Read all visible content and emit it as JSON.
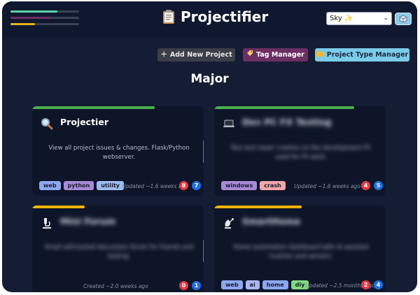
{
  "header": {
    "app_title": "Projectifier",
    "title_icon": "clipboard-icon",
    "progress_bars": [
      {
        "color": "#5dd6a8",
        "fill": 0.68
      },
      {
        "color": "#6b2f63",
        "fill": 0.58
      },
      {
        "color": "#e5b31f",
        "fill": 0.36
      }
    ],
    "theme_select": {
      "value": "Sky ✨"
    },
    "theme_button_icon": "cube-icon"
  },
  "toolbar": {
    "add_project": {
      "label": "Add New Project",
      "icon": "plus-icon"
    },
    "tag_manager": {
      "label": "Tag Manager",
      "icon": "tag-icon"
    },
    "project_type_manager": {
      "label": "Project Type Manager",
      "icon": "folder-icon"
    }
  },
  "section": {
    "title": "Major"
  },
  "colors": {
    "accent_green": "#4caf50",
    "accent_yellow": "#f5b400",
    "badge_red": "#e63946",
    "badge_blue": "#1e6fe8"
  },
  "cards": [
    {
      "name": "Projectier",
      "icon": "magnifier-icon",
      "description": "View all project issues & changes. Flask/Python webserver.",
      "tags": [
        {
          "label": "web",
          "color": "#8da7f0"
        },
        {
          "label": "python",
          "color": "#a78bd6"
        },
        {
          "label": "utility",
          "color": "#9dbdf1"
        }
      ],
      "status": "Updated ~1.6 weeks ago",
      "counts": {
        "red": "8",
        "blue": "7"
      },
      "accent": "#4caf50"
    },
    {
      "name": "Dev PC FX Testing",
      "icon": "laptop-icon",
      "description": "Test and repair crashes on the development PC used for FX work.",
      "tags": [
        {
          "label": "windows",
          "color": "#a78bd6"
        },
        {
          "label": "crash",
          "color": "#f0a8a8"
        }
      ],
      "status": "Updated ~1.6 weeks ago",
      "counts": {
        "red": "4",
        "blue": "5"
      },
      "accent": "#4caf50"
    },
    {
      "name": "Mini Forum",
      "icon": "microscope-icon",
      "description": "Small self-hosted discussion forum for friends and testing.",
      "tags": [],
      "status": "Created ~2.0 weeks ago",
      "counts": {
        "red": "0",
        "blue": "1"
      },
      "accent": "#f5b400"
    },
    {
      "name": "SmartHome",
      "icon": "satellite-icon",
      "description": "Home automation dashboard with AI assisted routines and sensors.",
      "tags": [
        {
          "label": "web",
          "color": "#8da7f0"
        },
        {
          "label": "ai",
          "color": "#a8b8f0"
        },
        {
          "label": "home",
          "color": "#8da7f0"
        },
        {
          "label": "diy",
          "color": "#7ddc7d"
        }
      ],
      "status": "Updated ~2.5 months ago",
      "counts": {
        "red": "2",
        "blue": "4"
      },
      "accent": "#f5b400"
    }
  ]
}
